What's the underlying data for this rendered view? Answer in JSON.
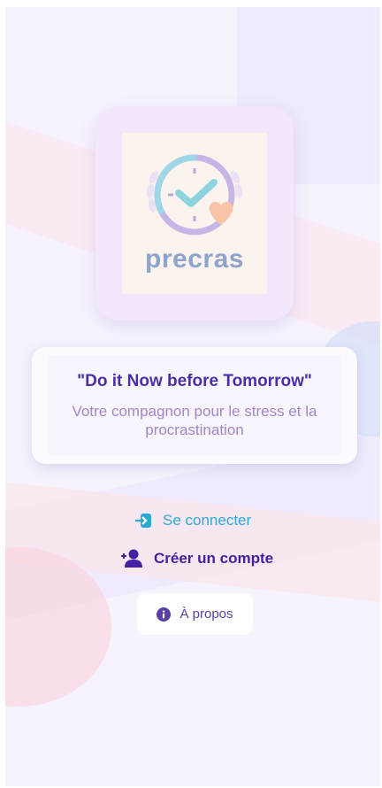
{
  "logo": {
    "text": "precras",
    "icon": "clock-heart-icon"
  },
  "tagline": {
    "title": "\"Do it Now before Tomorrow\"",
    "subtitle": "Votre compagnon pour le stress et la procrastination"
  },
  "actions": {
    "login_label": "Se connecter",
    "login_icon": "sign-in-icon",
    "signup_label": "Créer un compte",
    "signup_icon": "user-plus-icon",
    "about_label": "À propos",
    "about_icon": "info-circle-icon"
  },
  "colors": {
    "background": "#f6f3fd",
    "primary": "#4321a0",
    "login": "#2ea9d6",
    "subtitle": "#a486c8"
  }
}
